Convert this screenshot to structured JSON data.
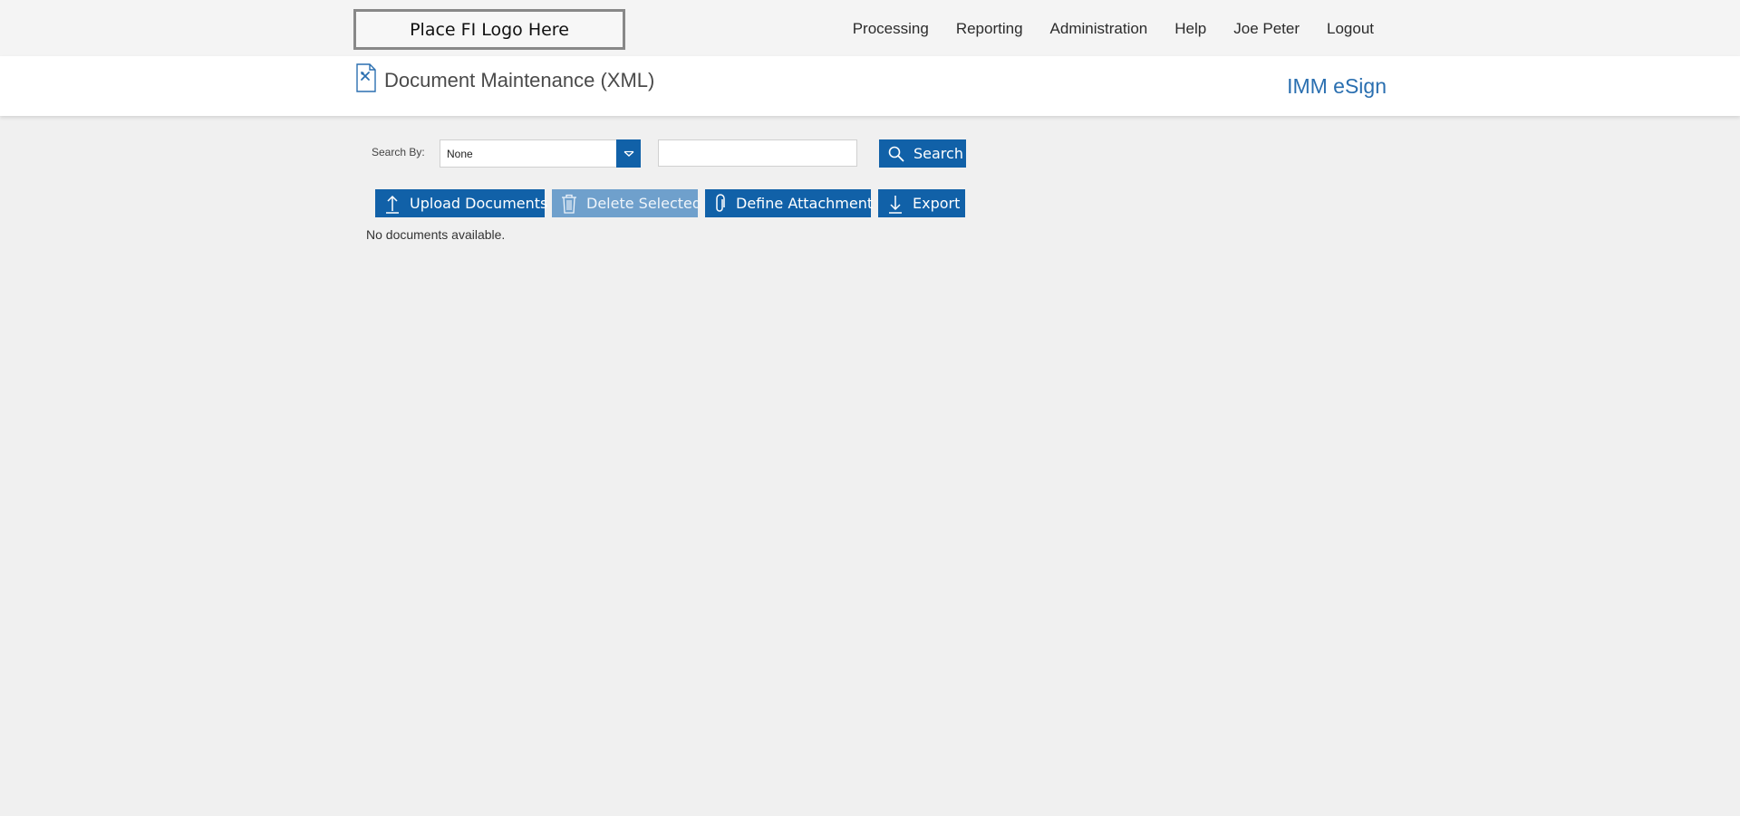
{
  "header": {
    "logo_text": "Place FI Logo Here",
    "nav": [
      {
        "label": "Processing"
      },
      {
        "label": "Reporting"
      },
      {
        "label": "Administration"
      },
      {
        "label": "Help"
      },
      {
        "label": "Joe Peter"
      },
      {
        "label": "Logout"
      }
    ]
  },
  "page": {
    "title": "Document Maintenance (XML)",
    "title_icon": "document-settings-icon",
    "product_name": "IMM eSign"
  },
  "search": {
    "label": "Search By:",
    "selected_option": "None",
    "input_value": "",
    "button_label": "Search",
    "button_icon": "search-icon"
  },
  "actions": {
    "upload_label": "Upload Documents",
    "upload_icon": "upload-icon",
    "delete_label": "Delete Selected",
    "delete_icon": "trash-icon",
    "attach_label": "Define Attachment",
    "attach_icon": "paperclip-icon",
    "export_label": "Export",
    "export_icon": "download-icon"
  },
  "content": {
    "empty_message": "No documents available."
  },
  "colors": {
    "accent": "#1161a8",
    "accent_disabled": "#6fa0cc",
    "product_text": "#2a6fb0",
    "background": "#f0f0f0"
  }
}
